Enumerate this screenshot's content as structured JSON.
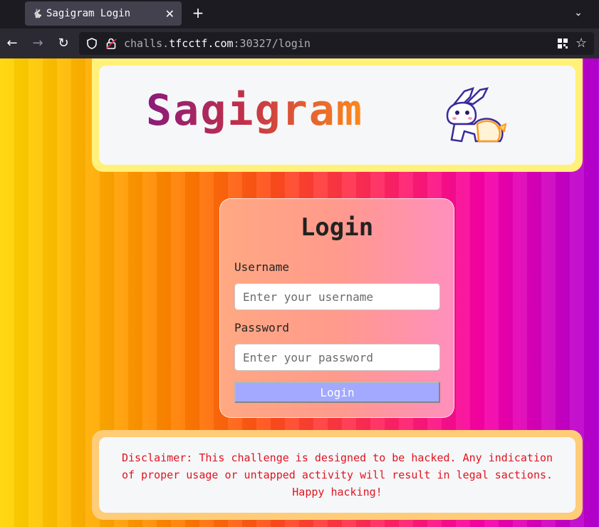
{
  "browser": {
    "tab": {
      "title": "Sagigram Login",
      "favicon": "bunny-favicon-icon"
    },
    "new_tab_label": "+",
    "url": {
      "scheme_host_prefix": "challs.",
      "host": "tfcctf.com",
      "rest": ":30327/login"
    }
  },
  "header": {
    "logo_text": "Sagigram",
    "mascot": "pixel-bunny-icon"
  },
  "login": {
    "title": "Login",
    "username_label": "Username",
    "username_placeholder": "Enter your username",
    "password_label": "Password",
    "password_placeholder": "Enter your password",
    "submit_label": "Login"
  },
  "disclaimer": {
    "text": "Disclaimer: This challenge is designed to be hacked. Any indication of proper usage or untapped activity will result in legal sactions. Happy hacking!"
  },
  "colors": {
    "header_border": "#fff17a",
    "disclaimer_border": "#ffcc78",
    "login_button": "#a3a9ff",
    "disclaimer_text": "#e0141e"
  }
}
